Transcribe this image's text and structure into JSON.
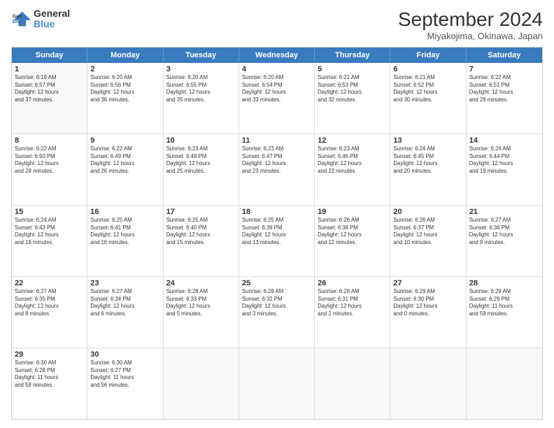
{
  "header": {
    "logo": {
      "line1": "General",
      "line2": "Blue"
    },
    "title": "September 2024",
    "subtitle": "Miyakojima, Okinawa, Japan"
  },
  "days": [
    "Sunday",
    "Monday",
    "Tuesday",
    "Wednesday",
    "Thursday",
    "Friday",
    "Saturday"
  ],
  "rows": [
    [
      {
        "day": "",
        "info": ""
      },
      {
        "day": "2",
        "info": "Sunrise: 6:20 AM\nSunset: 6:56 PM\nDaylight: 12 hours\nand 36 minutes."
      },
      {
        "day": "3",
        "info": "Sunrise: 6:20 AM\nSunset: 6:55 PM\nDaylight: 12 hours\nand 35 minutes."
      },
      {
        "day": "4",
        "info": "Sunrise: 6:20 AM\nSunset: 6:54 PM\nDaylight: 12 hours\nand 33 minutes."
      },
      {
        "day": "5",
        "info": "Sunrise: 6:21 AM\nSunset: 6:53 PM\nDaylight: 12 hours\nand 32 minutes."
      },
      {
        "day": "6",
        "info": "Sunrise: 6:21 AM\nSunset: 6:52 PM\nDaylight: 12 hours\nand 30 minutes."
      },
      {
        "day": "7",
        "info": "Sunrise: 6:22 AM\nSunset: 6:51 PM\nDaylight: 12 hours\nand 29 minutes."
      }
    ],
    [
      {
        "day": "8",
        "info": "Sunrise: 6:22 AM\nSunset: 6:50 PM\nDaylight: 12 hours\nand 28 minutes."
      },
      {
        "day": "9",
        "info": "Sunrise: 6:22 AM\nSunset: 6:49 PM\nDaylight: 12 hours\nand 26 minutes."
      },
      {
        "day": "10",
        "info": "Sunrise: 6:23 AM\nSunset: 6:48 PM\nDaylight: 12 hours\nand 25 minutes."
      },
      {
        "day": "11",
        "info": "Sunrise: 6:23 AM\nSunset: 6:47 PM\nDaylight: 12 hours\nand 23 minutes."
      },
      {
        "day": "12",
        "info": "Sunrise: 6:23 AM\nSunset: 6:46 PM\nDaylight: 12 hours\nand 22 minutes."
      },
      {
        "day": "13",
        "info": "Sunrise: 6:24 AM\nSunset: 6:45 PM\nDaylight: 12 hours\nand 20 minutes."
      },
      {
        "day": "14",
        "info": "Sunrise: 6:24 AM\nSunset: 6:44 PM\nDaylight: 12 hours\nand 19 minutes."
      }
    ],
    [
      {
        "day": "15",
        "info": "Sunrise: 6:24 AM\nSunset: 6:43 PM\nDaylight: 12 hours\nand 18 minutes."
      },
      {
        "day": "16",
        "info": "Sunrise: 6:25 AM\nSunset: 6:41 PM\nDaylight: 12 hours\nand 16 minutes."
      },
      {
        "day": "17",
        "info": "Sunrise: 6:25 AM\nSunset: 6:40 PM\nDaylight: 12 hours\nand 15 minutes."
      },
      {
        "day": "18",
        "info": "Sunrise: 6:25 AM\nSunset: 6:39 PM\nDaylight: 12 hours\nand 13 minutes."
      },
      {
        "day": "19",
        "info": "Sunrise: 6:26 AM\nSunset: 6:38 PM\nDaylight: 12 hours\nand 12 minutes."
      },
      {
        "day": "20",
        "info": "Sunrise: 6:26 AM\nSunset: 6:37 PM\nDaylight: 12 hours\nand 10 minutes."
      },
      {
        "day": "21",
        "info": "Sunrise: 6:27 AM\nSunset: 6:36 PM\nDaylight: 12 hours\nand 9 minutes."
      }
    ],
    [
      {
        "day": "22",
        "info": "Sunrise: 6:27 AM\nSunset: 6:35 PM\nDaylight: 12 hours\nand 8 minutes."
      },
      {
        "day": "23",
        "info": "Sunrise: 6:27 AM\nSunset: 6:34 PM\nDaylight: 12 hours\nand 6 minutes."
      },
      {
        "day": "24",
        "info": "Sunrise: 6:28 AM\nSunset: 6:33 PM\nDaylight: 12 hours\nand 5 minutes."
      },
      {
        "day": "25",
        "info": "Sunrise: 6:28 AM\nSunset: 6:32 PM\nDaylight: 12 hours\nand 3 minutes."
      },
      {
        "day": "26",
        "info": "Sunrise: 6:28 AM\nSunset: 6:31 PM\nDaylight: 12 hours\nand 2 minutes."
      },
      {
        "day": "27",
        "info": "Sunrise: 6:29 AM\nSunset: 6:30 PM\nDaylight: 12 hours\nand 0 minutes."
      },
      {
        "day": "28",
        "info": "Sunrise: 6:29 AM\nSunset: 6:29 PM\nDaylight: 11 hours\nand 59 minutes."
      }
    ],
    [
      {
        "day": "29",
        "info": "Sunrise: 6:30 AM\nSunset: 6:28 PM\nDaylight: 11 hours\nand 58 minutes."
      },
      {
        "day": "30",
        "info": "Sunrise: 6:30 AM\nSunset: 6:27 PM\nDaylight: 11 hours\nand 56 minutes."
      },
      {
        "day": "",
        "info": ""
      },
      {
        "day": "",
        "info": ""
      },
      {
        "day": "",
        "info": ""
      },
      {
        "day": "",
        "info": ""
      },
      {
        "day": "",
        "info": ""
      }
    ]
  ],
  "first_row_day1": {
    "day": "1",
    "info": "Sunrise: 6:19 AM\nSunset: 6:57 PM\nDaylight: 12 hours\nand 37 minutes."
  }
}
